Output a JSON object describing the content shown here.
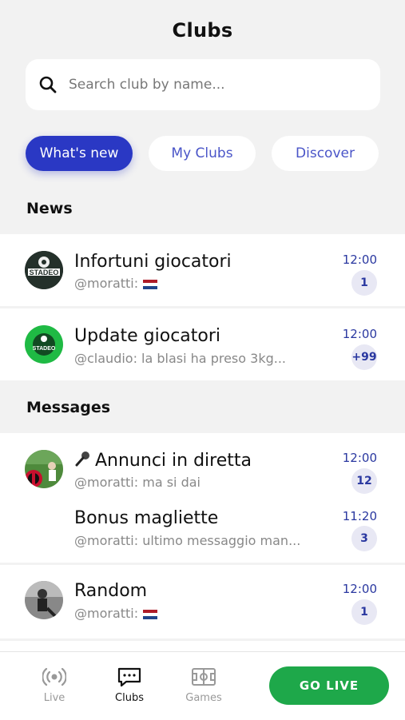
{
  "header": {
    "title": "Clubs"
  },
  "search": {
    "placeholder": "Search club by name..."
  },
  "tabs": [
    {
      "label": "What's new",
      "active": true
    },
    {
      "label": "My Clubs",
      "active": false
    },
    {
      "label": "Discover",
      "active": false
    }
  ],
  "sections": {
    "news": "News",
    "messages": "Messages"
  },
  "news": [
    {
      "title": "Infortuni giocatori",
      "subtitle": "@moratti:",
      "flag": "netherlands-flag",
      "time": "12:00",
      "badge": "1",
      "avatar": "stadeo-dark-logo"
    },
    {
      "title": "Update giocatori",
      "subtitle": "@claudio: la blasi ha preso 3kg...",
      "time": "12:00",
      "badge": "+99",
      "avatar": "stadeo-green-logo"
    }
  ],
  "messages": [
    {
      "title": "Annunci in diretta",
      "icon": "microphone-icon",
      "subtitle": "@moratti: ma si dai",
      "time": "12:00",
      "badge": "12",
      "avatar": "milan-photo"
    },
    {
      "title": "Bonus magliette",
      "subtitle": "@moratti: ultimo messaggio man...",
      "time": "11:20",
      "badge": "3"
    },
    {
      "title": "Random",
      "subtitle": "@moratti:",
      "flag": "netherlands-flag",
      "time": "12:00",
      "badge": "1",
      "avatar": "player-photo"
    }
  ],
  "bottom_nav": [
    {
      "label": "Live",
      "icon": "broadcast-icon",
      "active": false
    },
    {
      "label": "Clubs",
      "icon": "chat-icon",
      "active": true
    },
    {
      "label": "Games",
      "icon": "field-icon",
      "active": false
    }
  ],
  "go_live_label": "GO LIVE",
  "colors": {
    "accent": "#2a38c4",
    "live_green": "#1ea84a",
    "badge_bg": "#e8e8f4"
  }
}
